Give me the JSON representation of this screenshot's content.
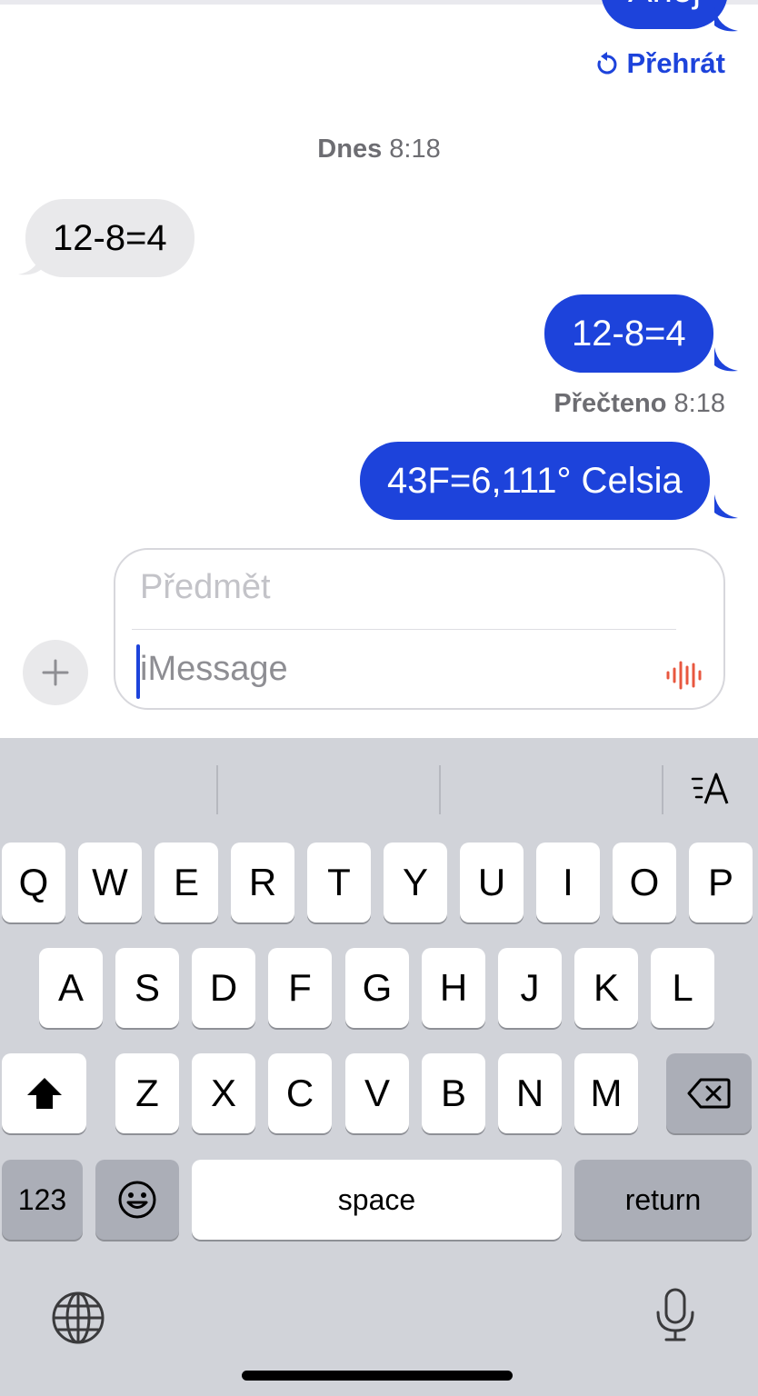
{
  "chat": {
    "top_bubble_partial": "Ahoj",
    "replay_label": "Přehrát",
    "timestamp_day": "Dnes",
    "timestamp_time": "8:18",
    "messages": [
      {
        "side": "in",
        "text": "12-8=4"
      },
      {
        "side": "out",
        "text": "12-8=4"
      },
      {
        "side": "out",
        "text": "43F=6,111° Celsia"
      }
    ],
    "read_label": "Přečteno",
    "read_time": "8:18"
  },
  "composer": {
    "subject_placeholder": "Předmět",
    "message_placeholder": "iMessage"
  },
  "keyboard": {
    "row1": [
      "Q",
      "W",
      "E",
      "R",
      "T",
      "Y",
      "U",
      "I",
      "O",
      "P"
    ],
    "row2": [
      "A",
      "S",
      "D",
      "F",
      "G",
      "H",
      "J",
      "K",
      "L"
    ],
    "row3": [
      "Z",
      "X",
      "C",
      "V",
      "B",
      "N",
      "M"
    ],
    "numbers_label": "123",
    "space_label": "space",
    "return_label": "return"
  },
  "colors": {
    "accent_blue": "#1d43db",
    "incoming_bubble": "#e9e9eb",
    "keyboard_bg": "#d1d3d9",
    "waveform": "#e8573f"
  }
}
